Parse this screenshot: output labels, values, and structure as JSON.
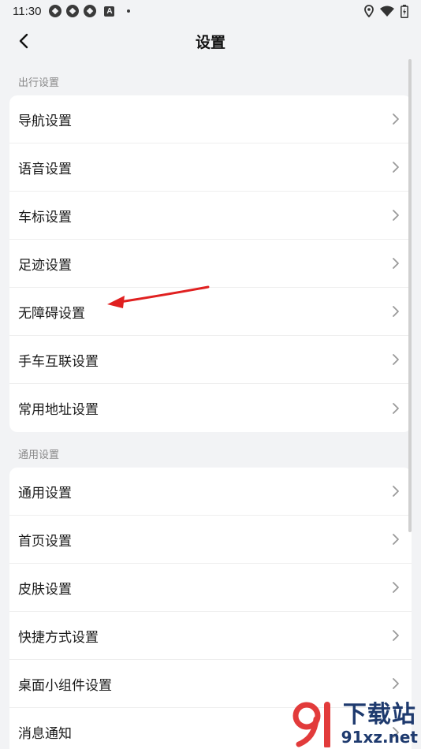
{
  "status_bar": {
    "time": "11:30",
    "icons_left": [
      "app-icon",
      "app-icon",
      "app-icon",
      "a-icon",
      "dot-icon"
    ],
    "icons_right": [
      "location-icon",
      "wifi-icon",
      "battery-icon"
    ]
  },
  "header": {
    "title": "设置",
    "back_icon": "chevron-left-icon"
  },
  "sections": [
    {
      "label": "出行设置",
      "items": [
        {
          "label": "导航设置"
        },
        {
          "label": "语音设置"
        },
        {
          "label": "车标设置"
        },
        {
          "label": "足迹设置"
        },
        {
          "label": "无障碍设置"
        },
        {
          "label": "手车互联设置"
        },
        {
          "label": "常用地址设置"
        }
      ]
    },
    {
      "label": "通用设置",
      "items": [
        {
          "label": "通用设置"
        },
        {
          "label": "首页设置"
        },
        {
          "label": "皮肤设置"
        },
        {
          "label": "快捷方式设置"
        },
        {
          "label": "桌面小组件设置"
        },
        {
          "label": "消息通知"
        }
      ]
    }
  ],
  "annotation": {
    "arrow_color": "#e02020",
    "points_to": "无障碍设置"
  },
  "watermark": {
    "main": "下载站",
    "sub": "91xz.net",
    "logo": "91-logo",
    "color": "#1e3a6e",
    "accent": "#e23b3b"
  }
}
